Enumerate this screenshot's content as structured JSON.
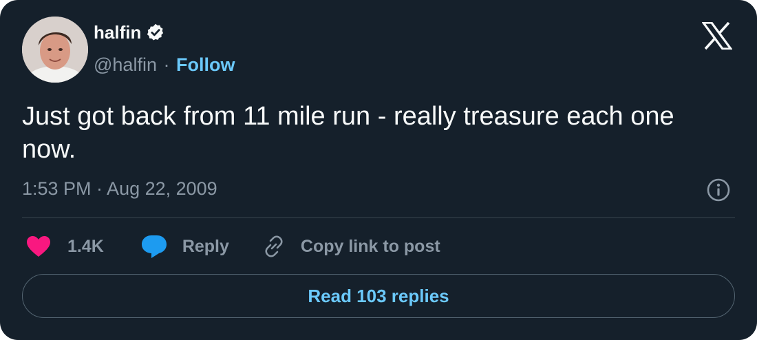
{
  "author": {
    "display_name": "halfin",
    "handle": "@halfin",
    "separator": "·",
    "follow_label": "Follow"
  },
  "tweet": {
    "text": "Just got back from 11 mile run - really treasure each one now.",
    "timestamp": "1:53 PM · Aug 22, 2009"
  },
  "actions": {
    "like_count": "1.4K",
    "reply_label": "Reply",
    "copy_label": "Copy link to post"
  },
  "read_replies_label": "Read 103 replies",
  "icons": {
    "brand": "x-logo-icon",
    "verified": "verified-badge-icon",
    "info": "info-icon",
    "like": "heart-icon",
    "reply": "speech-bubble-icon",
    "copy": "link-icon"
  },
  "colors": {
    "background": "#15202b",
    "text": "#f7f9f9",
    "secondary": "#8b98a5",
    "accent": "#6bc9fb",
    "like": "#f91880",
    "reply": "#1d9bf0",
    "divider": "#38444d"
  }
}
